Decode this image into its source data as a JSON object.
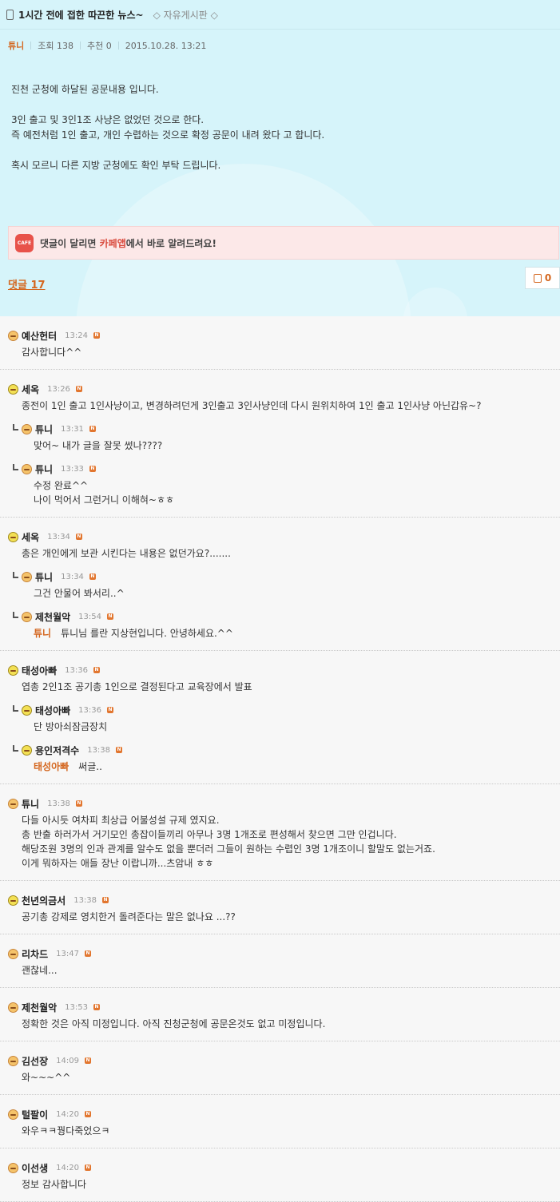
{
  "post": {
    "title": "1시간 전에 접한 따끈한 뉴스~",
    "board": "◇ 자유게시판 ◇",
    "author": "튜니",
    "views": "조회 138",
    "recommend": "추천 0",
    "date": "2015.10.28. 13:21",
    "body": [
      [
        "진천 군청에 하달된 공문내용 입니다."
      ],
      [
        "3인 출고 및 3인1조 사냥은 없었던 것으로 한다.",
        "즉 예전처럼 1인 출고, 개인 수렵하는 것으로 확정 공문이 내려 왔다 고 합니다."
      ],
      [
        "혹시 모르니 다른 지방 군청에도 확인 부탁 드립니다."
      ]
    ],
    "cafe_prefix": "댓글이 달리면 ",
    "cafe_highlight": "카페앱",
    "cafe_suffix": "에서 바로 알려드려요!",
    "cafe_logo": "CAFE",
    "comment_link": "댓글 17",
    "like_count": "0"
  },
  "colors": {
    "accent": "#d4661e",
    "header_bg": "#d6f4fa",
    "banner_bg": "#fce8e8"
  },
  "new_badge": "N",
  "comments": [
    {
      "items": [
        {
          "name": "예산헌터",
          "time": "13:24",
          "reply": false,
          "icon": "face",
          "lines": [
            "감사합니다^^"
          ]
        }
      ]
    },
    {
      "items": [
        {
          "name": "세옥",
          "time": "13:26",
          "reply": false,
          "icon": "helmet",
          "lines": [
            "종전이 1인 출고 1인사냥이고, 변경하려던게 3인출고 3인사냥인데 다시 원위치하여 1인 출고 1인사냥 아닌갑유~?"
          ]
        },
        {
          "name": "튜니",
          "time": "13:31",
          "reply": true,
          "icon": "face",
          "lines": [
            "맞어~ 내가 글을 잘못 썼나????"
          ]
        },
        {
          "name": "튜니",
          "time": "13:33",
          "reply": true,
          "icon": "face",
          "lines": [
            "수정 완료^^",
            "나이 먹어서 그런거니 이해혀~ㅎㅎ"
          ]
        }
      ]
    },
    {
      "items": [
        {
          "name": "세옥",
          "time": "13:34",
          "reply": false,
          "icon": "helmet",
          "lines": [
            "총은 개인에게 보관 시킨다는 내용은 없던가요?......."
          ]
        },
        {
          "name": "튜니",
          "time": "13:34",
          "reply": true,
          "icon": "face",
          "lines": [
            "그건 안물어 봐서리..^"
          ]
        },
        {
          "name": "제천월악",
          "time": "13:54",
          "reply": true,
          "icon": "face",
          "mention": "튜니",
          "lines": [
            "튜니님 를란 지상현입니다. 안녕하세요.^^"
          ]
        }
      ]
    },
    {
      "items": [
        {
          "name": "태성아빠",
          "time": "13:36",
          "reply": false,
          "icon": "helmet",
          "lines": [
            "엽총 2인1조 공기총 1인으로 결정된다고 교육장에서 발표"
          ]
        },
        {
          "name": "태성아빠",
          "time": "13:36",
          "reply": true,
          "icon": "helmet",
          "lines": [
            "단 방아쇠잠금장치"
          ]
        },
        {
          "name": "용인저격수",
          "time": "13:38",
          "reply": true,
          "icon": "helmet",
          "mention": "태성아빠",
          "lines": [
            "써글.."
          ]
        }
      ]
    },
    {
      "items": [
        {
          "name": "튜니",
          "time": "13:38",
          "reply": false,
          "icon": "face",
          "lines": [
            "다들 아시듯 여차피 최상급 어불성설 규제 였지요.",
            "총 반출 하러가서 거기모인 총잡이들끼리 아무나 3명 1개조로 편성해서 찾으면 그만 인겁니다.",
            "해당조원 3명의 인과 관계를 알수도 없을 뿐더러 그들이 원하는 수렵인 3명 1개조이니 할말도 없는거죠.",
            "이게 뭐하자는 애들 장난 이랍니까...츠암내 ㅎㅎ"
          ]
        }
      ]
    },
    {
      "items": [
        {
          "name": "천년의금서",
          "time": "13:38",
          "reply": false,
          "icon": "helmet",
          "lines": [
            "공기총 강제로 영치한거 돌려준다는 말은 없나요 ...??"
          ]
        }
      ]
    },
    {
      "items": [
        {
          "name": "리차드",
          "time": "13:47",
          "reply": false,
          "icon": "face",
          "lines": [
            "괜찮네..."
          ]
        }
      ]
    },
    {
      "items": [
        {
          "name": "제천월악",
          "time": "13:53",
          "reply": false,
          "icon": "face",
          "lines": [
            "정확한 것은 아직 미정입니다. 아직 진청군청에 공문온것도 없고 미정입니다."
          ]
        }
      ]
    },
    {
      "items": [
        {
          "name": "김선장",
          "time": "14:09",
          "reply": false,
          "icon": "face",
          "lines": [
            "와~~~^^"
          ]
        }
      ]
    },
    {
      "items": [
        {
          "name": "털팔이",
          "time": "14:20",
          "reply": false,
          "icon": "face",
          "lines": [
            "와우ㅋㅋ꿩다죽었으ㅋ"
          ]
        }
      ]
    },
    {
      "items": [
        {
          "name": "이선생",
          "time": "14:20",
          "reply": false,
          "icon": "face",
          "lines": [
            "정보 감사합니다"
          ]
        }
      ]
    }
  ]
}
